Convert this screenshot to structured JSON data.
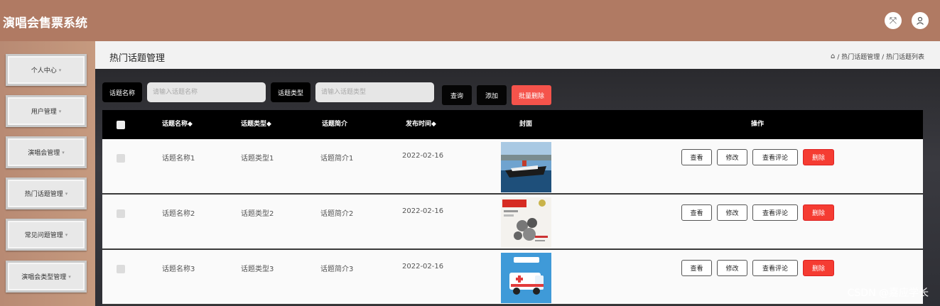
{
  "app": {
    "title": "演唱会售票系统"
  },
  "topbar": {
    "fullscreen_icon": "fullscreen-icon",
    "user_icon": "user-icon"
  },
  "sidebar": {
    "items": [
      {
        "label": "个人中心",
        "caret": "▾"
      },
      {
        "label": "用户管理",
        "caret": "▾"
      },
      {
        "label": "演唱会管理",
        "caret": "▾"
      },
      {
        "label": "热门话题管理",
        "caret": "▾"
      },
      {
        "label": "常见问题管理",
        "caret": "▾"
      },
      {
        "label": "演唱会类型管理",
        "caret": "▾"
      }
    ]
  },
  "header": {
    "title": "热门话题管理",
    "breadcrumb": " / 热门话题管理 / 热门话题列表"
  },
  "search": {
    "name_label": "话题名称",
    "name_placeholder": "请输入话题名称",
    "type_label": "话题类型",
    "type_placeholder": "请输入话题类型",
    "query_button": "查询",
    "add_button": "添加",
    "batch_delete_button": "批量删除"
  },
  "table": {
    "columns": [
      "话题名称◆",
      "话题类型◆",
      "话题简介",
      "发布时间◆",
      "封面",
      "操作"
    ],
    "rows": [
      {
        "name": "话题名称1",
        "type": "话题类型1",
        "intro": "话题简介1",
        "date": "2022-02-16",
        "cover": "cruise-ship"
      },
      {
        "name": "话题名称2",
        "type": "话题类型2",
        "intro": "话题简介2",
        "date": "2022-02-16",
        "cover": "magazine"
      },
      {
        "name": "话题名称3",
        "type": "话题类型3",
        "intro": "话题简介3",
        "date": "2022-02-16",
        "cover": "ambulance"
      }
    ],
    "actions": {
      "view": "查看",
      "edit": "修改",
      "comments": "查看评论",
      "delete": "删除"
    }
  },
  "watermark": "CSDN @嘉应学长",
  "colors": {
    "topbar": "#b07a63",
    "danger": "#f5534b",
    "header_bg": "#000000"
  }
}
